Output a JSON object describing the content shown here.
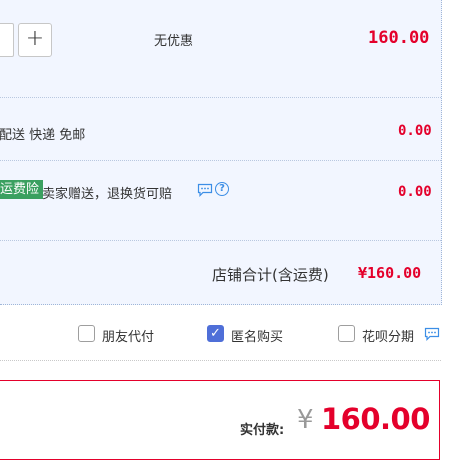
{
  "item": {
    "qty_plus": "+",
    "discount": "无优惠",
    "price": "160.00"
  },
  "shipping": {
    "label": "配送 快递 免邮",
    "price": "0.00"
  },
  "insurance": {
    "tag": "运费险",
    "desc": "卖家赠送，退换货可赔",
    "help": "?",
    "price": "0.00"
  },
  "store_total": {
    "label": "店铺合计(含运费)",
    "value": "¥160.00"
  },
  "options": [
    {
      "label": "朋友代付",
      "checked": false
    },
    {
      "label": "匿名购买",
      "checked": true
    },
    {
      "label": "花呗分期",
      "checked": false
    }
  ],
  "payment": {
    "label": "实付款:",
    "currency": "¥",
    "amount": "160.00"
  },
  "colors": {
    "accent_red": "#e4002b",
    "panel_bg": "#f2f6ff",
    "tag_green": "#3aa060",
    "checkbox_blue": "#4f6fd8",
    "icon_blue": "#3c8ee6"
  }
}
